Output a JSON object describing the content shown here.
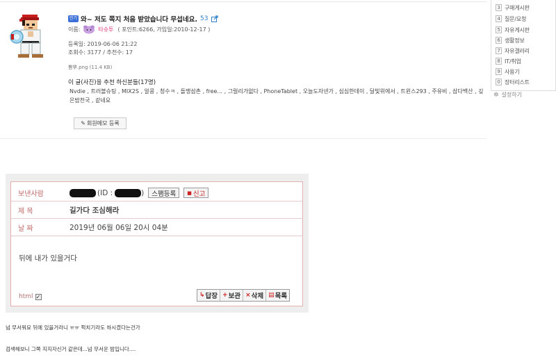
{
  "side_nav": {
    "items": [
      {
        "num": "3",
        "label": "구매게시판"
      },
      {
        "num": "4",
        "label": "질문/요청"
      },
      {
        "num": "5",
        "label": "자유게시판"
      },
      {
        "num": "6",
        "label": "생활정보"
      },
      {
        "num": "7",
        "label": "자유갤러리"
      },
      {
        "num": "8",
        "label": "IT/취업"
      },
      {
        "num": "9",
        "label": "사용기"
      },
      {
        "num": "0",
        "label": "장터리스트"
      }
    ],
    "settings_label": "설정하기"
  },
  "post": {
    "badge": "인기",
    "title": "와~ 저도 쪽지 처음 받았습니다 무섭네요.",
    "comment_count": "53",
    "name_label": "이름:",
    "nickname": "타슈투",
    "user_info": "( 포인트:6266, 가입일:2010-12-17 )",
    "date_line": "등록일: 2019-06-06 21:22",
    "views_line": "조회수: 3177 / 추천수: 17",
    "attachment": "뽐뿌.png (11.4 KB)",
    "recommenders_title": "이 글(사진)을 추천 하신분들(17명)",
    "recommenders": "Nvdie , 트러블슈팅 , MIX2S , 알콩 , 청수ㅋ , 돌맹삼촌 , free... , 그럴리가없다 , PhoneTablet , 오늘도자넨가 , 심심한데이 , 달빛위에서 , 트윈스293 , 주유비 , 삼다백산 , 깊은밤천국 , 같네요",
    "memo_button": "회원메모 등록"
  },
  "message": {
    "sender_label": "보낸사람",
    "sender_id_prefix": "(ID :",
    "sender_id_suffix": ")",
    "spam_button": "스팸등록",
    "report_button": "신고",
    "subject_label": "제 목",
    "subject_value": "길가다 조심해라",
    "date_label": "날 짜",
    "date_value": "2019년 06월 06일 20시 04분",
    "body": "뒤에 내가 있을거다",
    "html_label": "html",
    "actions": [
      {
        "icon": "↳",
        "label": "답장"
      },
      {
        "icon": "+",
        "label": "보관"
      },
      {
        "icon": "×",
        "label": "삭제"
      },
      {
        "icon": "▤",
        "label": "목록"
      }
    ]
  },
  "comments": {
    "line1": "넘 무서워요 뒤에 있을거라니 ㅠㅠ 퍽치기라도 하시겠다는건가",
    "line2": "검색해보니 그쪽 지지자신거 같은데...넘 무서운 밤입니다...."
  },
  "colors": {
    "accent_blue": "#2e7fc8",
    "nickname_pink": "#e0397a",
    "label_red": "#c06a6a",
    "border_pink": "#e3b0b0"
  }
}
